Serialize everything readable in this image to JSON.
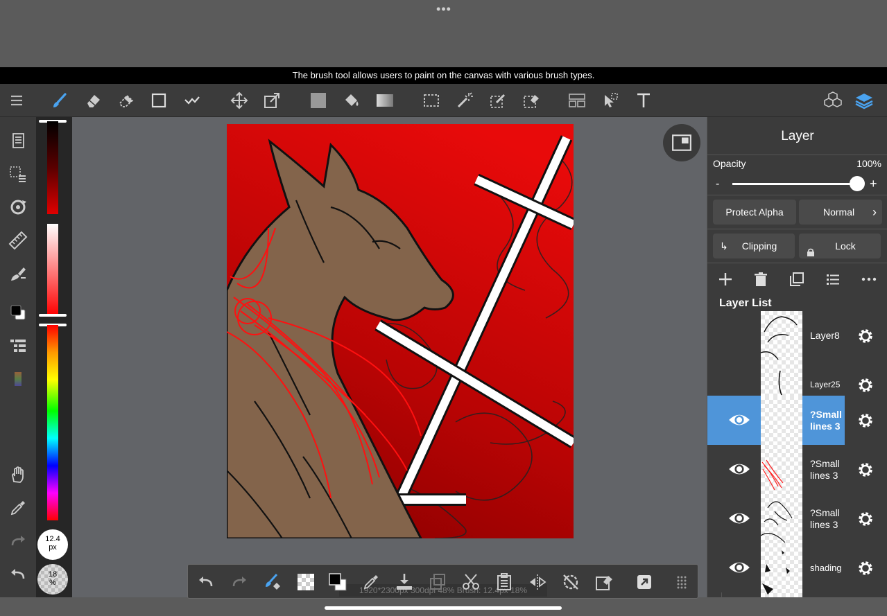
{
  "top": {
    "more_label": "•••"
  },
  "tooltip": {
    "text": "The brush tool allows users to paint on the canvas with various brush types."
  },
  "colors": {
    "accent": "#4f95d9",
    "toolbar_bg": "#3b3b3b",
    "canvas_bg": "#626468",
    "active_tool": "#4aa3f0"
  },
  "toolbar": {
    "icons": [
      "menu-icon",
      "brush-icon",
      "eraser-icon",
      "blur-eraser-icon",
      "shape-icon",
      "select-line-icon",
      "move-icon",
      "transform-icon",
      "fill-color-icon",
      "bucket-icon",
      "gradient-icon",
      "rect-select-icon",
      "magic-wand-icon",
      "select-pen-icon",
      "select-eraser-icon",
      "frame-divider-icon",
      "operation-icon",
      "text-icon",
      "3d-model-icon",
      "layers-icon"
    ]
  },
  "brush": {
    "size": "12.4",
    "size_unit": "px",
    "opacity": "18",
    "opacity_unit": "%"
  },
  "bottom_bar": {
    "status": "1920*2300px 300dpi 48% Brush: 12.4px 18%"
  },
  "layer_panel": {
    "title": "Layer",
    "opacity_label": "Opacity",
    "opacity_value": "100%",
    "opacity_minus": "-",
    "opacity_plus": "+",
    "opacity_level": 1.0,
    "protect_alpha": "Protect Alpha",
    "blend_mode": "Normal",
    "clipping": "Clipping",
    "lock": "Lock",
    "list_title": "Layer List",
    "layers": [
      {
        "name": "Layer8",
        "visible": false,
        "selected": false
      },
      {
        "name": "Layer25",
        "visible": false,
        "selected": false
      },
      {
        "name": "?Small lines 3",
        "visible": true,
        "selected": true
      },
      {
        "name": "?Small lines 3",
        "visible": true,
        "selected": false
      },
      {
        "name": "?Small lines 3",
        "visible": true,
        "selected": false
      },
      {
        "name": "shading",
        "visible": true,
        "selected": false
      }
    ]
  }
}
